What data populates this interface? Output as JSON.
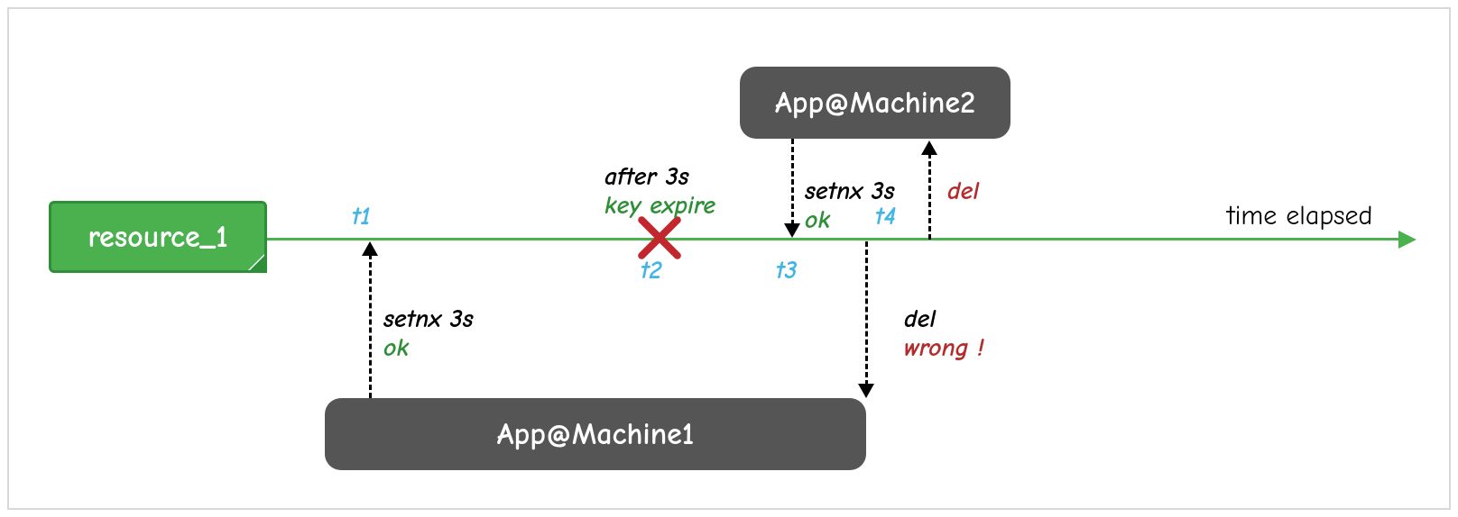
{
  "resource_label": "resource_1",
  "machine1_label": "App@Machine1",
  "machine2_label": "App@Machine2",
  "axis_label": "time elapsed",
  "t1": "t1",
  "t2": "t2",
  "t3": "t3",
  "t4": "t4",
  "m1_setnx_cmd": "setnx 3s",
  "m1_setnx_ok": "ok",
  "expire_after": "after 3s",
  "expire_key": "key expire",
  "m2_setnx_cmd": "setnx 3s",
  "m2_setnx_ok": "ok",
  "m1_del_cmd": "del",
  "m1_del_wrong": "wrong !",
  "m2_del_cmd": "del",
  "colors": {
    "resource_bg": "#4bb04e",
    "resource_border": "#2f8f39",
    "machine_bg": "#555555",
    "timeline": "#4bb04e",
    "time_label": "#41b6e6",
    "ok": "#2f8f39",
    "cmd": "#000000",
    "error": "#b42b2b",
    "x": "#c1272d"
  }
}
